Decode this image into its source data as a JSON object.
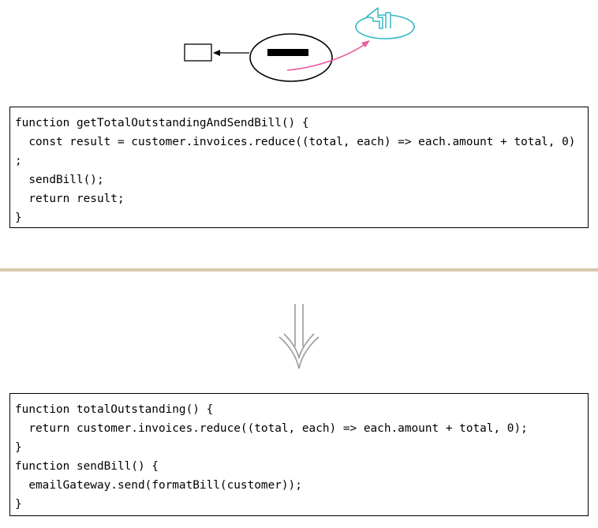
{
  "colors": {
    "pink_arrow": "#e8599d",
    "cyan_icon": "#36b8c4",
    "divider": "#d9c9ad",
    "down_arrow": "#9a9a9a"
  },
  "icons": {
    "illustration": [
      "rectangle-icon",
      "arrow-left-icon",
      "oval-icon",
      "black-bar-icon",
      "pink-curved-arrow-icon",
      "cyan-cloud-arrow-icon"
    ],
    "transition": "double-down-arrow-icon"
  },
  "before_code": [
    "function getTotalOutstandingAndSendBill() {",
    "  const result = customer.invoices.reduce((total, each) => each.amount + total, 0)",
    ";",
    "  sendBill();",
    "  return result;",
    "}"
  ],
  "after_code": [
    "function totalOutstanding() {",
    "  return customer.invoices.reduce((total, each) => each.amount + total, 0);",
    "}",
    "function sendBill() {",
    "  emailGateway.send(formatBill(customer));",
    "}"
  ]
}
